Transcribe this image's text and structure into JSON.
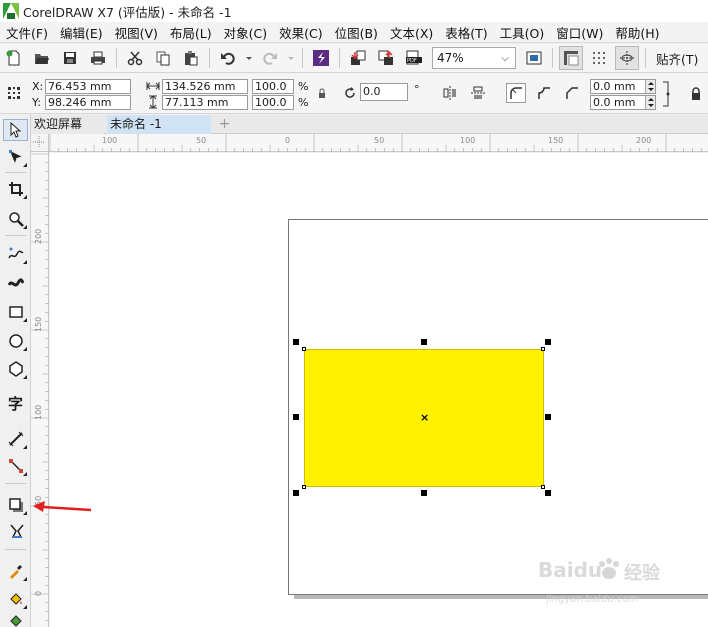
{
  "window": {
    "title": "CorelDRAW X7 (评估版) - 未命名 -1"
  },
  "menu": [
    "文件(F)",
    "编辑(E)",
    "视图(V)",
    "布局(L)",
    "对象(C)",
    "效果(C)",
    "位图(B)",
    "文本(X)",
    "表格(T)",
    "工具(O)",
    "窗口(W)",
    "帮助(H)"
  ],
  "toolbar": {
    "zoom_value": "47%",
    "align_label": "贴齐(T)"
  },
  "property_bar": {
    "x_label": "X:",
    "y_label": "Y:",
    "x_value": "76.453 mm",
    "y_value": "98.246 mm",
    "width_value": "134.526 mm",
    "height_value": "77.113 mm",
    "scale_x": "100.0",
    "scale_y": "100.0",
    "percent_symbol": "%",
    "rotation_value": "0.0",
    "degree_symbol": "°",
    "corner_top": "0.0 mm",
    "corner_bottom": "0.0 mm"
  },
  "tabs": {
    "welcome": "欢迎屏幕",
    "document": "未命名 -1",
    "add": "+"
  },
  "ruler": {
    "h_labels": [
      "100",
      "50",
      "0",
      "50",
      "100",
      "150",
      "200"
    ],
    "v_labels": [
      "200",
      "150",
      "100",
      "50",
      "0"
    ]
  },
  "toolbox": {
    "text_tool_glyph": "字"
  },
  "shape": {
    "fill_color": "#fff100"
  },
  "watermark": {
    "brand": "Baidu",
    "brand_cn": "经验",
    "url": "jingyan.baidu.com"
  }
}
